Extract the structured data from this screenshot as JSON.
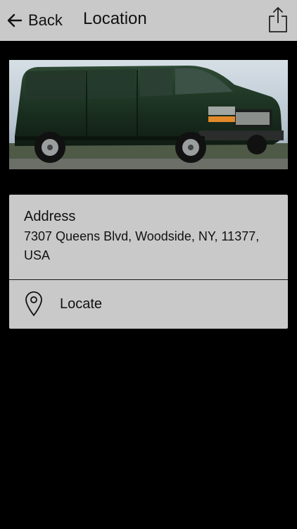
{
  "header": {
    "back_label": "Back",
    "title": "Location",
    "icons": {
      "back": "arrow-left-icon",
      "share": "share-icon"
    }
  },
  "hero": {
    "alt": "van-photo"
  },
  "address": {
    "heading": "Address",
    "text": "7307 Queens Blvd, Woodside, NY, 11377, USA"
  },
  "locate": {
    "label": "Locate",
    "icon": "map-pin-icon"
  },
  "colors": {
    "bar_bg": "#c9c9c9",
    "page_bg": "#000000",
    "card_bg": "#c9c9c9",
    "text": "#111111"
  }
}
